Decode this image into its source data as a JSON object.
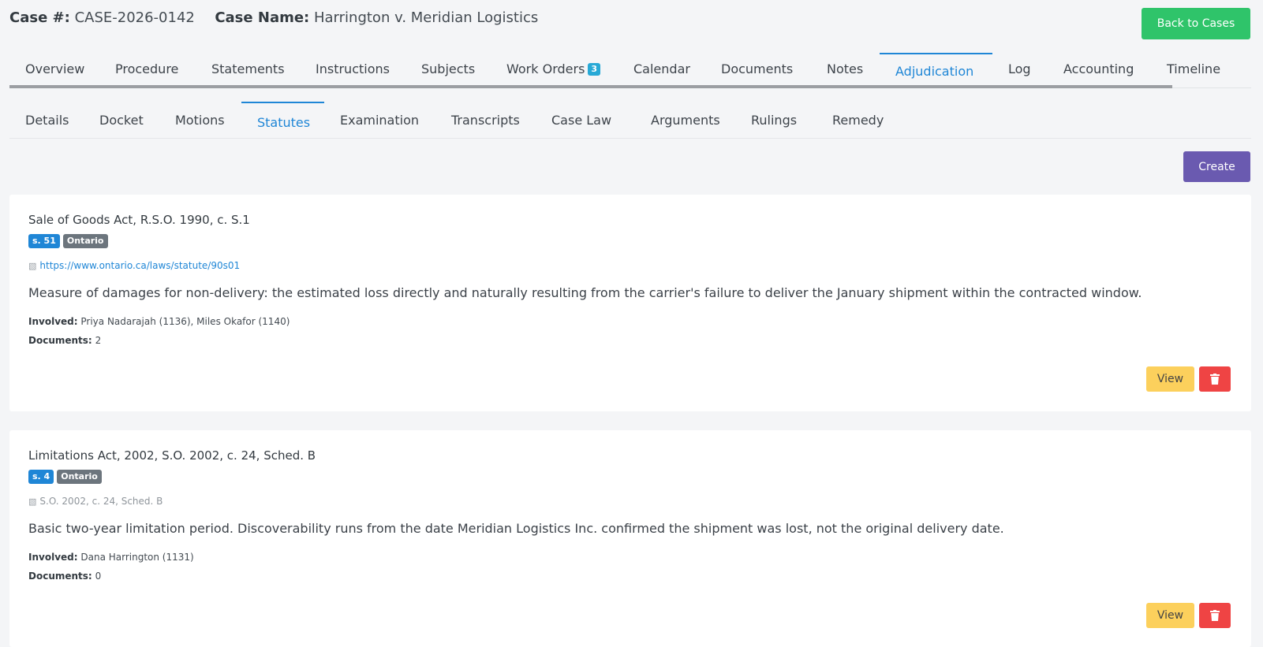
{
  "header": {
    "case_num_label": "Case #:",
    "case_num": "CASE-2026-0142",
    "case_name_label": "Case Name:",
    "case_name": "Harrington v. Meridian Logistics",
    "back_label": "Back to Cases"
  },
  "main_tabs": [
    {
      "label": "Overview"
    },
    {
      "label": "Procedure"
    },
    {
      "label": "Statements"
    },
    {
      "label": "Instructions"
    },
    {
      "label": "Subjects"
    },
    {
      "label": "Work Orders",
      "badge": "3"
    },
    {
      "label": "Calendar"
    },
    {
      "label": "Documents"
    },
    {
      "label": "Notes"
    },
    {
      "label": "Adjudication",
      "active": true
    },
    {
      "label": "Log"
    },
    {
      "label": "Accounting"
    },
    {
      "label": "Timeline"
    }
  ],
  "sub_tabs": [
    {
      "label": "Details"
    },
    {
      "label": "Docket"
    },
    {
      "label": "Motions"
    },
    {
      "label": "Statutes",
      "active": true
    },
    {
      "label": "Examination"
    },
    {
      "label": "Transcripts"
    },
    {
      "label": "Case Law"
    },
    {
      "label": "Arguments"
    },
    {
      "label": "Rulings"
    },
    {
      "label": "Remedy"
    }
  ],
  "toolbar": {
    "create_label": "Create"
  },
  "labels": {
    "involved": "Involved:",
    "documents": "Documents:",
    "view": "View"
  },
  "statutes": [
    {
      "title": "Sale of Goods Act, R.S.O. 1990, c. S.1",
      "section": "s. 51",
      "jurisdiction": "Ontario",
      "reference": "https://www.ontario.ca/laws/statute/90s01",
      "reference_is_link": true,
      "description": "Measure of damages for non-delivery: the estimated loss directly and naturally resulting from the carrier's failure to deliver the January shipment within the contracted window.",
      "involved": "Priya Nadarajah (1136), Miles Okafor (1140)",
      "documents": "2"
    },
    {
      "title": "Limitations Act, 2002, S.O. 2002, c. 24, Sched. B",
      "section": "s. 4",
      "jurisdiction": "Ontario",
      "reference": "S.O. 2002, c. 24, Sched. B",
      "reference_is_link": false,
      "description": "Basic two-year limitation period. Discoverability runs from the date Meridian Logistics Inc. confirmed the shipment was lost, not the original delivery date.",
      "involved": "Dana Harrington (1131)",
      "documents": "0"
    }
  ],
  "colors": {
    "accent": "#1f86d6",
    "back_button": "#2fc46a",
    "create_button": "#6a5ab0",
    "view_button": "#fcd05c",
    "delete_button": "#ef4444"
  }
}
